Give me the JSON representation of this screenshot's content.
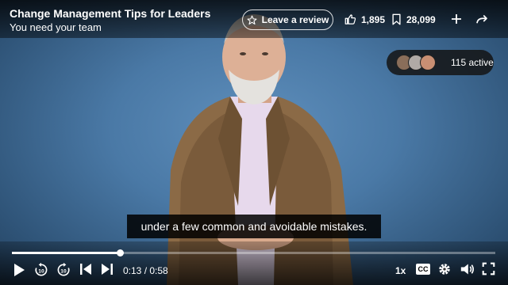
{
  "header": {
    "title": "Change Management Tips for Leaders",
    "subtitle": "You need your team",
    "review_label": "Leave a review",
    "likes": "1,895",
    "saves": "28,099"
  },
  "viewers": {
    "active_label": "115 active"
  },
  "caption": "under a few common and avoidable mistakes.",
  "controls": {
    "time": "0:13 / 0:58",
    "speed": "1x",
    "cc_label": "CC",
    "progress_fraction": 0.224
  },
  "icons": {
    "review": "star-icon",
    "like": "thumbs-up-icon",
    "save": "bookmark-icon",
    "add": "plus-icon",
    "share": "share-arrow-icon",
    "play": "play-icon",
    "rewind": "rewind-10-icon",
    "forward": "forward-10-icon",
    "prev": "skip-previous-icon",
    "next": "skip-next-icon",
    "settings": "gear-icon",
    "volume": "volume-icon",
    "fullscreen": "fullscreen-icon"
  }
}
